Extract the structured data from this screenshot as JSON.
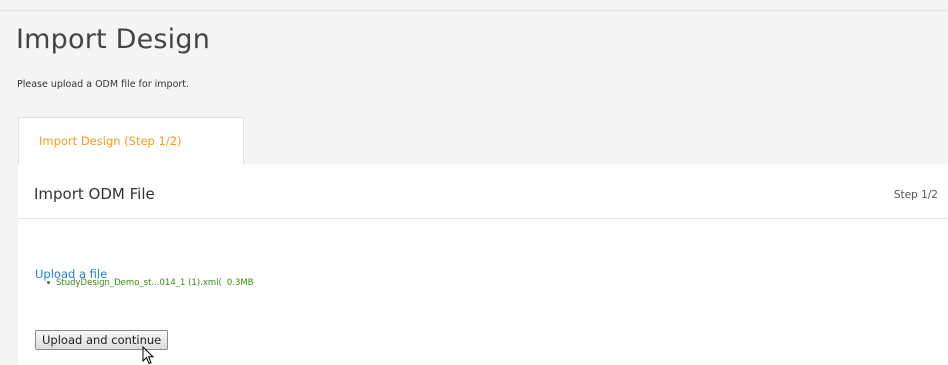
{
  "page": {
    "title": "Import Design",
    "subtitle": "Please upload a ODM file for import."
  },
  "tab": {
    "label": "Import Design (Step 1/2)",
    "accent_color": "#f59a1b"
  },
  "panel": {
    "title": "Import ODM File",
    "step": "Step 1/2",
    "upload_link_label": "Upload a file",
    "file": {
      "name": "StudyDesign_Demo_st...014_1 (1).xml(",
      "size": "0.3MB"
    },
    "continue_button_label": "Upload and continue"
  },
  "colors": {
    "link": "#1e80d8",
    "file_text": "#3a8a10"
  },
  "cursor": {
    "icon": "mouse-pointer-icon"
  }
}
